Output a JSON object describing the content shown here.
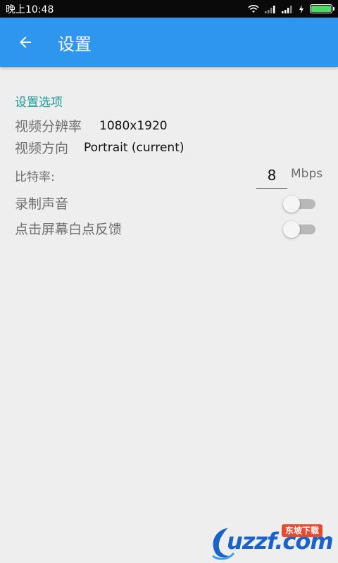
{
  "status_bar": {
    "time": "晚上10:48",
    "icons": [
      "wifi-icon",
      "signal-icon",
      "signal-icon",
      "charging-icon",
      "battery-icon"
    ],
    "battery_color": "#4cd964"
  },
  "app_bar": {
    "back_icon": "arrow-left-icon",
    "title": "设置",
    "color": "#2f96f0"
  },
  "settings": {
    "section_title": "设置选项",
    "resolution": {
      "label": "视频分辨率",
      "value": "1080x1920"
    },
    "orientation": {
      "label": "视频方向",
      "value": "Portrait (current)"
    },
    "bitrate": {
      "label": "比特率:",
      "value": "8",
      "unit": "Mbps"
    },
    "record_audio": {
      "label": "录制声音",
      "on": false
    },
    "touch_feedback": {
      "label": "点击屏幕白点反馈",
      "on": false
    }
  },
  "watermark": {
    "text": "uzzf.com",
    "badge": "东坡下载"
  }
}
